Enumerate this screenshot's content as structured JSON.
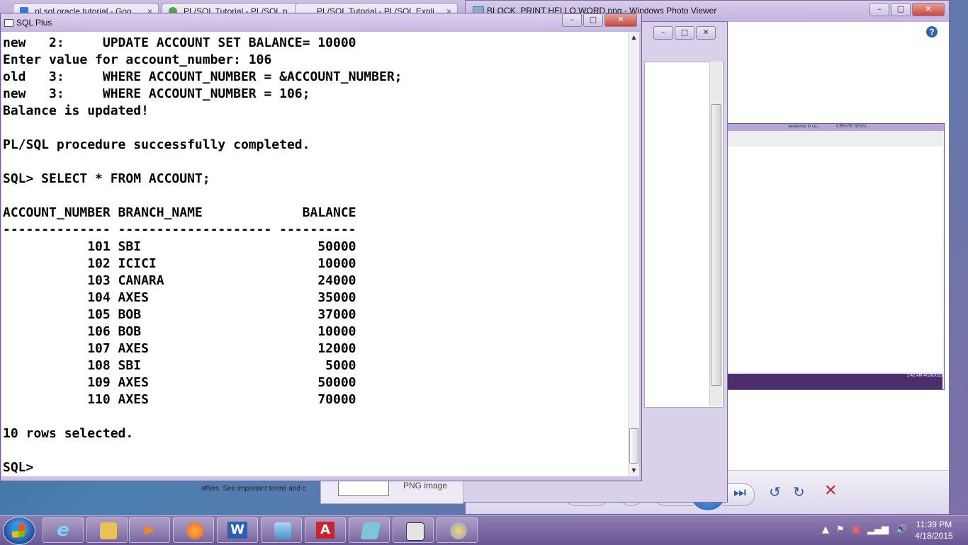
{
  "browser_tabs": [
    {
      "label": "pl sql oracle tutorial - Goo"
    },
    {
      "label": "PL/SQL Tutorial - PL/SQL p"
    },
    {
      "label": "PL/SQL Tutorial - PL/SQL Expli"
    }
  ],
  "photo_viewer": {
    "title": "BLOCK_PRINT HELLO WORD.png - Windows Photo Viewer",
    "help_glyph": "?",
    "embedded_tabs": [
      "sequence in sq...",
      "CREATE SEQU..."
    ],
    "embedded_clock": "1:42 AM 4/18/2015"
  },
  "background_peek": {
    "png_label": "PNG image",
    "offers_text": "offers. See important terms and c"
  },
  "sqlplus": {
    "title": "SQL Plus",
    "lines": [
      "new   2:     UPDATE ACCOUNT SET BALANCE= 10000",
      "Enter value for account_number: 106",
      "old   3:     WHERE ACCOUNT_NUMBER = &ACCOUNT_NUMBER;",
      "new   3:     WHERE ACCOUNT_NUMBER = 106;",
      "Balance is updated!",
      "",
      "PL/SQL procedure successfully completed.",
      "",
      "SQL> SELECT * FROM ACCOUNT;",
      "",
      "ACCOUNT_NUMBER BRANCH_NAME             BALANCE",
      "-------------- -------------------- ----------",
      "           101 SBI                       50000",
      "           102 ICICI                     10000",
      "           103 CANARA                    24000",
      "           104 AXES                      35000",
      "           105 BOB                       37000",
      "           106 BOB                       10000",
      "           107 AXES                      12000",
      "           108 SBI                        5000",
      "           109 AXES                      50000",
      "           110 AXES                      70000",
      "",
      "10 rows selected.",
      "",
      "SQL>"
    ]
  },
  "taskbar": {
    "apps": [
      {
        "name": "internet-explorer",
        "glyph": "e",
        "color": "#2a8de0"
      },
      {
        "name": "file-explorer",
        "glyph": "",
        "color": "#e8c253"
      },
      {
        "name": "media-player",
        "glyph": "▶",
        "color": "#f08a24"
      },
      {
        "name": "firefox",
        "glyph": "",
        "color": "#e8612c"
      },
      {
        "name": "word",
        "glyph": "W",
        "color": "#2b5fb4"
      },
      {
        "name": "photo-viewer",
        "glyph": "",
        "color": "#5fa4d9"
      },
      {
        "name": "acrobat",
        "glyph": "A",
        "color": "#c9242b"
      },
      {
        "name": "sql-tool",
        "glyph": "",
        "color": "#7fc4d8"
      },
      {
        "name": "sqlplus",
        "glyph": "",
        "color": "#e3e3e3"
      },
      {
        "name": "paint",
        "glyph": "",
        "color": "#8a9fd6"
      }
    ],
    "time": "11:39 PM",
    "date": "4/18/2015"
  }
}
